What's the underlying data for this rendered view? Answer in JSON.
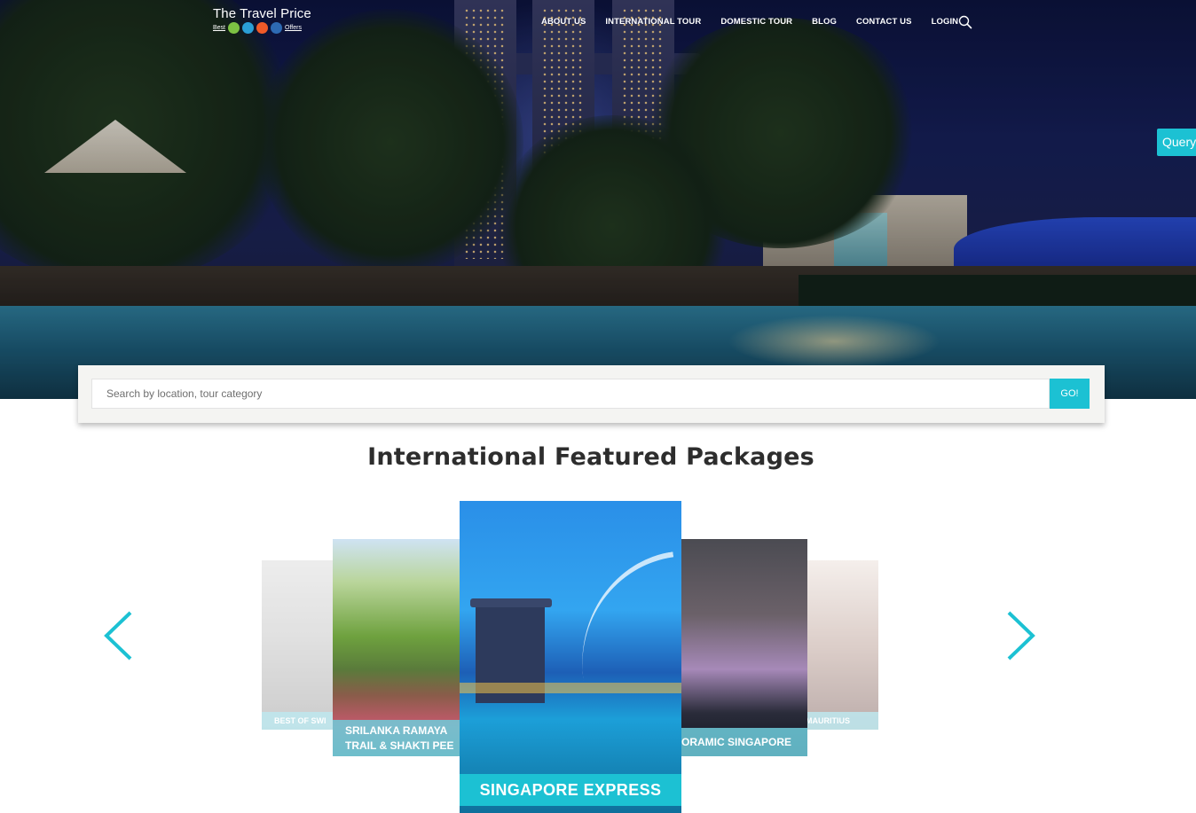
{
  "header": {
    "logo_title": "The Travel Price",
    "logo_tagline_left": "Best",
    "logo_tagline_right": "Offers",
    "nav": [
      {
        "label": "ABOUT US"
      },
      {
        "label": "INTERNATIONAL TOUR"
      },
      {
        "label": "DOMESTIC TOUR"
      },
      {
        "label": "BLOG"
      },
      {
        "label": "CONTACT US"
      },
      {
        "label": "LOGIN"
      }
    ],
    "search_icon": "search-icon"
  },
  "query_tab": {
    "label": "Query"
  },
  "search": {
    "placeholder": "Search by location, tour category",
    "value": "",
    "button_label": "GO!"
  },
  "featured": {
    "title": "International Featured Packages",
    "prev_icon": "chevron-left-icon",
    "next_icon": "chevron-right-icon",
    "cards": [
      {
        "label": "BEST OF SWI"
      },
      {
        "label": "SRILANKA RAMAYA TRAIL & SHAKTI PEE"
      },
      {
        "label": "SINGAPORE EXPRESS"
      },
      {
        "label": "ORAMIC SINGAPORE"
      },
      {
        "label": "MAURITIUS"
      }
    ]
  },
  "colors": {
    "accent": "#1cc1d3",
    "heading": "#2d2d2d",
    "hero_dark": "#16205a"
  }
}
